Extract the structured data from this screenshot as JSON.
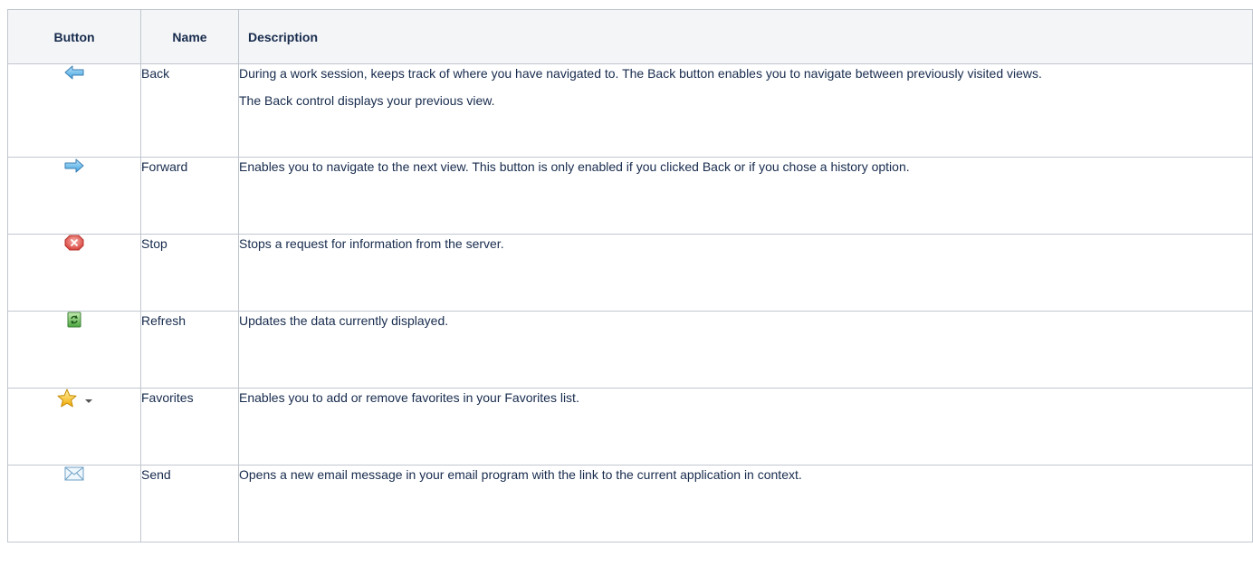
{
  "table": {
    "headers": {
      "button": "Button",
      "name": "Name",
      "description": "Description"
    },
    "rows": [
      {
        "icon": "back-arrow-icon",
        "name": "Back",
        "description": [
          "During a work session, keeps track of where you have navigated to. The Back button enables you to navigate between previously visited views.",
          "The Back control displays your previous view."
        ]
      },
      {
        "icon": "forward-arrow-icon",
        "name": "Forward",
        "description": [
          "Enables you to navigate to the next view. This button is only enabled if you clicked Back or if you chose a history option."
        ]
      },
      {
        "icon": "stop-icon",
        "name": "Stop",
        "description": [
          "Stops a request for information from the server."
        ]
      },
      {
        "icon": "refresh-icon",
        "name": "Refresh",
        "description": [
          "Updates the data currently displayed."
        ]
      },
      {
        "icon": "favorites-star-icon",
        "name": "Favorites",
        "description": [
          "Enables you to add or remove favorites in your Favorites list."
        ]
      },
      {
        "icon": "send-envelope-icon",
        "name": "Send",
        "description": [
          "Opens a new email message in your email program with the link to the current application in context."
        ]
      }
    ]
  },
  "colors": {
    "header_bg": "#f4f5f7",
    "border": "#c1c7d0",
    "arrow_blue": "#5ab4ea",
    "stop_red": "#e0524f",
    "refresh_green": "#5cb85c",
    "star_yellow": "#f7c425"
  }
}
